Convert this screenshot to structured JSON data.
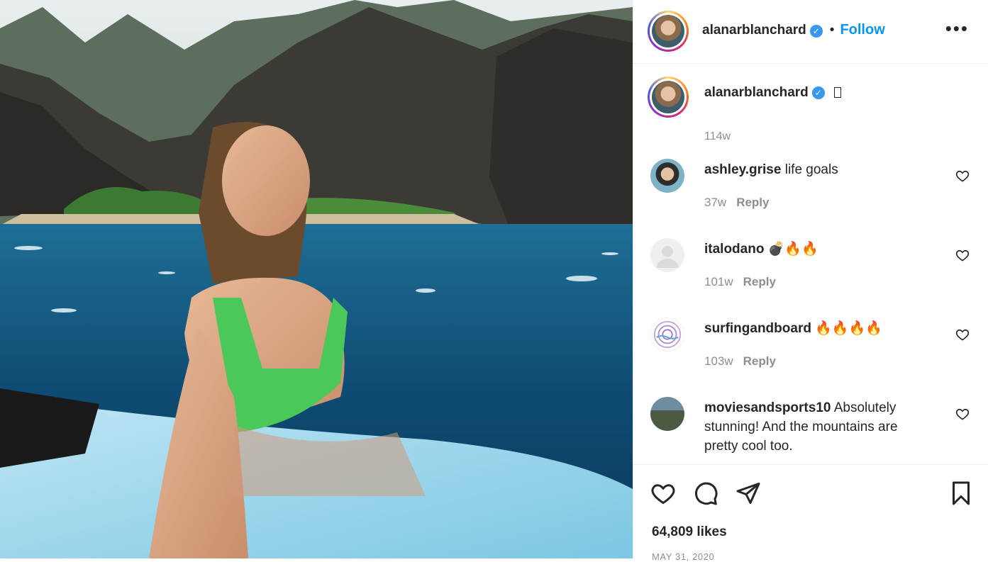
{
  "post": {
    "image_alt": "",
    "username": "alanarblanchard",
    "verified": true,
    "separator": "•",
    "follow_label": "Follow",
    "more_icon": "more-icon"
  },
  "caption": {
    "username": "alanarblanchard",
    "text": "",
    "age": "114w"
  },
  "comments": [
    {
      "username": "ashley.grise",
      "text": "life goals",
      "age": "37w",
      "reply_label": "Reply"
    },
    {
      "username": "italodano",
      "text": "💣🔥🔥",
      "age": "101w",
      "reply_label": "Reply"
    },
    {
      "username": "surfingandboard",
      "text": "🔥🔥🔥🔥",
      "age": "103w",
      "reply_label": "Reply"
    },
    {
      "username": "moviesandsports10",
      "text": "Absolutely stunning! And the mountains are pretty cool too.",
      "age": "",
      "reply_label": ""
    }
  ],
  "actions": {
    "like_icon": "heart-icon",
    "comment_icon": "comment-icon",
    "share_icon": "send-icon",
    "save_icon": "bookmark-icon"
  },
  "likes_text": "64,809 likes",
  "date_text": "MAY 31, 2020",
  "colors": {
    "link": "#0095f6",
    "verified": "#3897f0",
    "muted": "#8e8e8e",
    "text": "#262626"
  }
}
